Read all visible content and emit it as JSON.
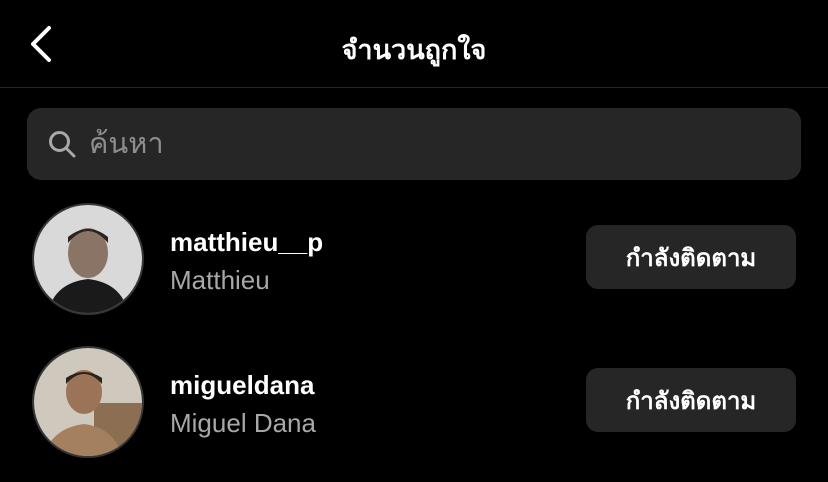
{
  "header": {
    "title": "จำนวนถูกใจ",
    "back_icon": "chevron-left-icon"
  },
  "search": {
    "placeholder": "ค้นหา",
    "value": "",
    "icon": "search-icon"
  },
  "users": [
    {
      "username": "matthieu__p",
      "full_name": "Matthieu",
      "button_label": "กำลังติดตาม"
    },
    {
      "username": "migueldana",
      "full_name": "Miguel Dana",
      "button_label": "กำลังติดตาม"
    }
  ],
  "colors": {
    "background": "#000000",
    "surface": "#262626",
    "primary_text": "#ffffff",
    "secondary_text": "#a8a8a8",
    "placeholder": "#8e8e8e"
  }
}
